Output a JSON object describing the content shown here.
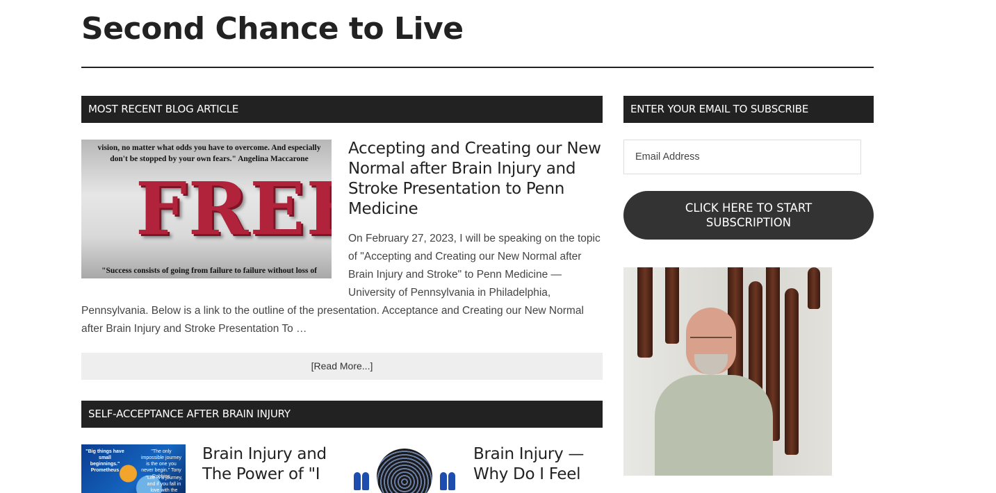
{
  "site": {
    "title": "Second Chance to Live"
  },
  "recent": {
    "heading": "MOST RECENT BLOG ARTICLE",
    "image": {
      "quote_top": "vision, no matter what odds you have to overcome. And especially don't be stopped by your own fears.\" Angelina Maccarone",
      "word": "FREE",
      "quote_bottom": "\"Success consists of going from failure to failure without loss of"
    },
    "title": "Accepting and Creating our New Normal after Brain Injury and Stroke Presentation to Penn Medicine",
    "excerpt_lines": [
      "On February 27, 2023, I will be speaking on the topic",
      "of \"Accepting and Creating our New Normal after",
      "Brain Injury and Stroke\" to Penn Medicine —",
      "University of Pennsylvania in Philadelphia,",
      "Pennsylvania. Below is a link to the outline of the presentation. Acceptance and Creating our New Normal",
      "after Brain Injury and Stroke Presentation To …"
    ],
    "read_more": "[Read More...]"
  },
  "self_acceptance": {
    "heading": "SELF-ACCEPTANCE AFTER BRAIN INJURY",
    "posts": [
      {
        "title": "Brain Injury and The Power of \"I",
        "thumb_text": [
          "\"Big things have small beginnings.\" Prometheus",
          "\"The only impossible journey is the one you never begin.\" Tony Robbins",
          "\"Life is a journey, and if you fall in love with the journey, you will"
        ]
      },
      {
        "title": "Brain Injury — Why Do I Feel"
      }
    ]
  },
  "sidebar": {
    "subscribe_heading": "ENTER YOUR EMAIL TO SUBSCRIBE",
    "email_placeholder": "Email Address",
    "subscribe_button": "CLICK HERE TO START SUBSCRIPTION"
  },
  "colors": {
    "bar": "#222222",
    "button": "#333333",
    "read_more_bg": "#eeeeee"
  }
}
